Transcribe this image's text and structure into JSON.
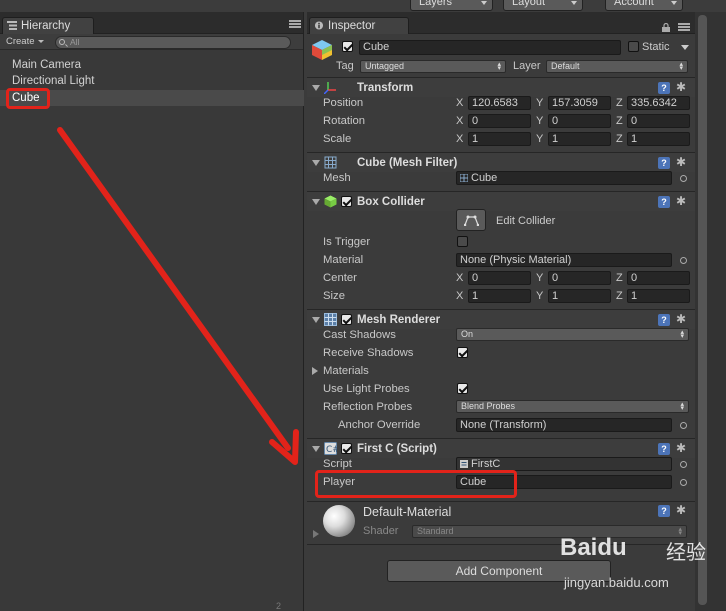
{
  "topbar": {
    "layers": "Layers",
    "layout": "Layout",
    "account": "Account"
  },
  "hierarchy": {
    "tab": "Hierarchy",
    "create": "Create",
    "search_placeholder": "All",
    "items": [
      {
        "label": "Main Camera",
        "selected": false
      },
      {
        "label": "Directional Light",
        "selected": false
      },
      {
        "label": "Cube",
        "selected": true
      }
    ],
    "footer_mark": "2"
  },
  "inspector": {
    "tab": "Inspector",
    "object_name": "Cube",
    "static_label": "Static",
    "tag_label": "Tag",
    "tag_value": "Untagged",
    "layer_label": "Layer",
    "layer_value": "Default",
    "transform": {
      "title": "Transform",
      "position_label": "Position",
      "position": {
        "x": "120.6583",
        "y": "157.3059",
        "z": "335.6342"
      },
      "rotation_label": "Rotation",
      "rotation": {
        "x": "0",
        "y": "0",
        "z": "0"
      },
      "scale_label": "Scale",
      "scale": {
        "x": "1",
        "y": "1",
        "z": "1"
      }
    },
    "mesh_filter": {
      "title": "Cube (Mesh Filter)",
      "mesh_label": "Mesh",
      "mesh_value": "Cube"
    },
    "box_collider": {
      "title": "Box Collider",
      "edit_label": "Edit Collider",
      "is_trigger_label": "Is Trigger",
      "material_label": "Material",
      "material_value": "None (Physic Material)",
      "center_label": "Center",
      "center": {
        "x": "0",
        "y": "0",
        "z": "0"
      },
      "size_label": "Size",
      "size": {
        "x": "1",
        "y": "1",
        "z": "1"
      }
    },
    "mesh_renderer": {
      "title": "Mesh Renderer",
      "cast_shadows_label": "Cast Shadows",
      "cast_shadows_value": "On",
      "receive_shadows_label": "Receive Shadows",
      "materials_label": "Materials",
      "light_probes_label": "Use Light Probes",
      "reflection_probes_label": "Reflection Probes",
      "reflection_probes_value": "Blend Probes",
      "anchor_label": "Anchor Override",
      "anchor_value": "None (Transform)"
    },
    "script_comp": {
      "title": "First C (Script)",
      "script_label": "Script",
      "script_value": "FirstC",
      "player_label": "Player",
      "player_value": "Cube"
    },
    "material": {
      "title": "Default-Material",
      "shader_label": "Shader",
      "shader_value": "Standard"
    },
    "add_component": "Add Component"
  },
  "axes": {
    "x": "X",
    "y": "Y",
    "z": "Z"
  },
  "watermark": {
    "brand": "Baidu",
    "brand_cn": "经验",
    "url": "jingyan.baidu.com"
  },
  "colors": {
    "highlight": "#e2231a",
    "help_blue": "#4c74b8",
    "panel": "#3b3b3b"
  }
}
